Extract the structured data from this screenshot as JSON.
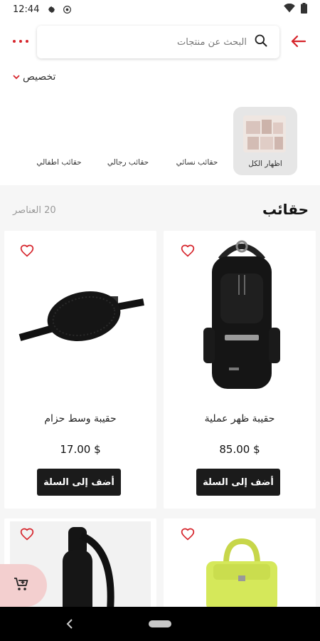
{
  "status_bar": {
    "time": "12:44",
    "icons_left": [
      "gear-icon",
      "shield-icon"
    ],
    "icons_right": [
      "wifi-icon",
      "battery-icon"
    ]
  },
  "header": {
    "search_placeholder": "البحث عن منتجات",
    "icons": [
      "more-dots-icon",
      "search-icon",
      "back-arrow-icon"
    ]
  },
  "customize": {
    "label": "تخصيص"
  },
  "categories": {
    "selected": "اظهار الكل",
    "items": [
      "حقائب نسائي",
      "حقائب رجالي",
      "حقائب اطفالي"
    ]
  },
  "section": {
    "title": "حقائب",
    "count": "20 العناصر"
  },
  "products": [
    {
      "name": "حقيبة ظهر عملية",
      "price": "85.00 $",
      "button": "أضف إلى السلة",
      "image": "black-backpack"
    },
    {
      "name": "حقيبة وسط حزام",
      "price": "17.00 $",
      "button": "أضف إلى السلة",
      "image": "black-waist-bag"
    },
    {
      "name": "",
      "price": "",
      "button": "",
      "image": "lime-handbag"
    },
    {
      "name": "",
      "price": "",
      "button": "",
      "image": "black-sling-bag"
    }
  ],
  "colors": {
    "accent": "#d6242b",
    "button_bg": "#1b1b1b",
    "fab_bg": "#f3cfcf"
  }
}
